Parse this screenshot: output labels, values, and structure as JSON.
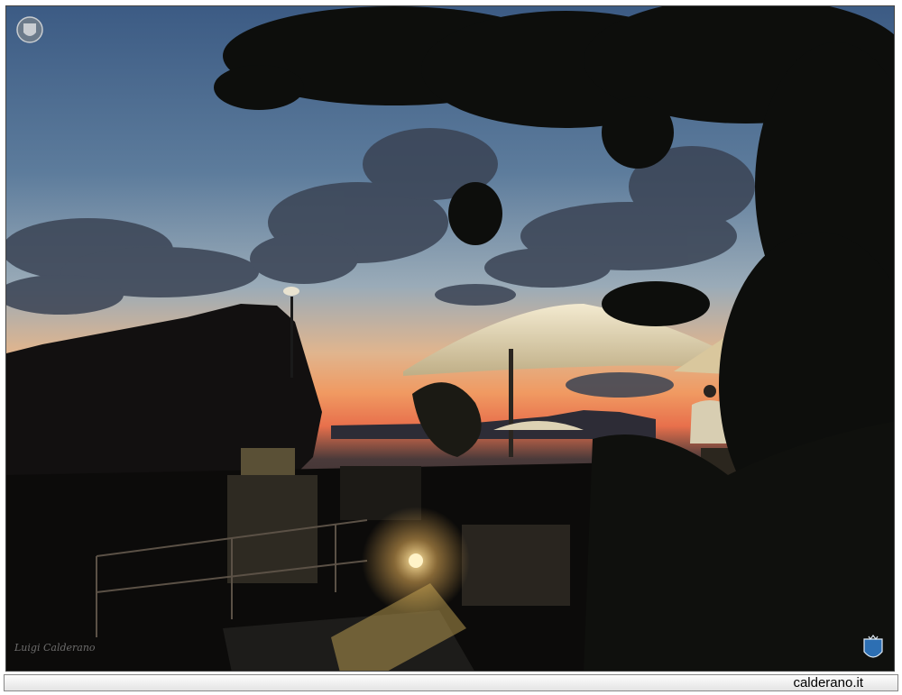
{
  "photo": {
    "alt_subject": "sunset-terrace",
    "sky_colors": {
      "top": "#3e5f87",
      "mid": "#7f98ae",
      "horizon": "#f0a86a",
      "glow": "#f2734a"
    }
  },
  "watermark": {
    "crest_icon": "crest-icon",
    "signature_text": "Luigi Calderano",
    "corner_logo_icon": "shield-logo-icon"
  },
  "footer": {
    "site_name": "calderano.it"
  }
}
